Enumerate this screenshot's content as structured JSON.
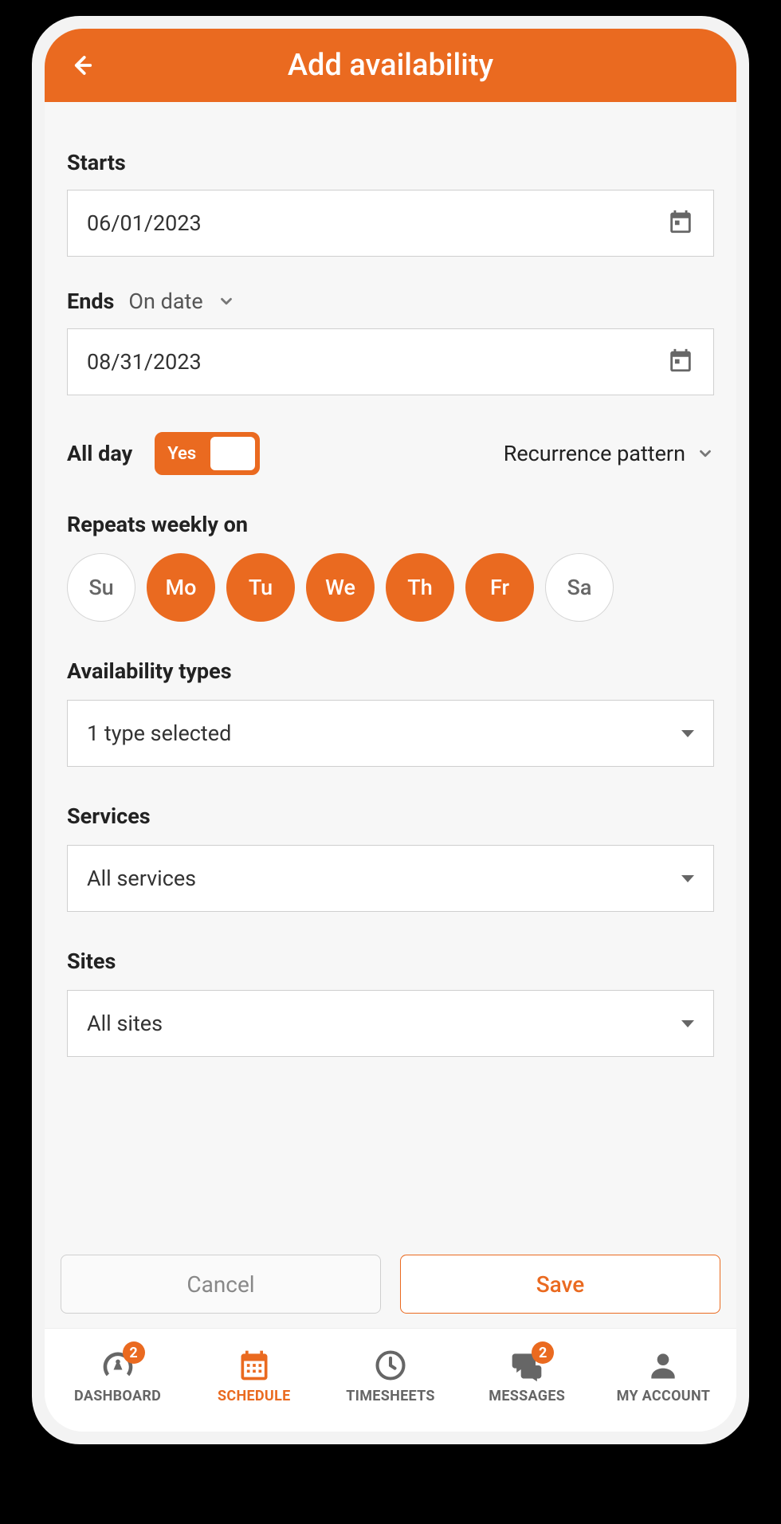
{
  "header": {
    "title": "Add availability"
  },
  "starts": {
    "label": "Starts",
    "value": "06/01/2023"
  },
  "ends": {
    "label": "Ends",
    "mode": "On date",
    "value": "08/31/2023"
  },
  "allday": {
    "label": "All day",
    "toggle_label": "Yes"
  },
  "recurrence": {
    "label": "Recurrence pattern"
  },
  "repeats": {
    "label": "Repeats weekly on",
    "days": [
      {
        "abbr": "Su",
        "selected": false
      },
      {
        "abbr": "Mo",
        "selected": true
      },
      {
        "abbr": "Tu",
        "selected": true
      },
      {
        "abbr": "We",
        "selected": true
      },
      {
        "abbr": "Th",
        "selected": true
      },
      {
        "abbr": "Fr",
        "selected": true
      },
      {
        "abbr": "Sa",
        "selected": false
      }
    ]
  },
  "avail_types": {
    "label": "Availability types",
    "value": "1 type selected"
  },
  "services": {
    "label": "Services",
    "value": "All services"
  },
  "sites": {
    "label": "Sites",
    "value": "All sites"
  },
  "buttons": {
    "cancel": "Cancel",
    "save": "Save"
  },
  "tabs": {
    "dashboard": {
      "label": "DASHBOARD",
      "badge": "2"
    },
    "schedule": {
      "label": "SCHEDULE"
    },
    "timesheets": {
      "label": "TIMESHEETS"
    },
    "messages": {
      "label": "MESSAGES",
      "badge": "2"
    },
    "account": {
      "label": "MY ACCOUNT"
    }
  }
}
